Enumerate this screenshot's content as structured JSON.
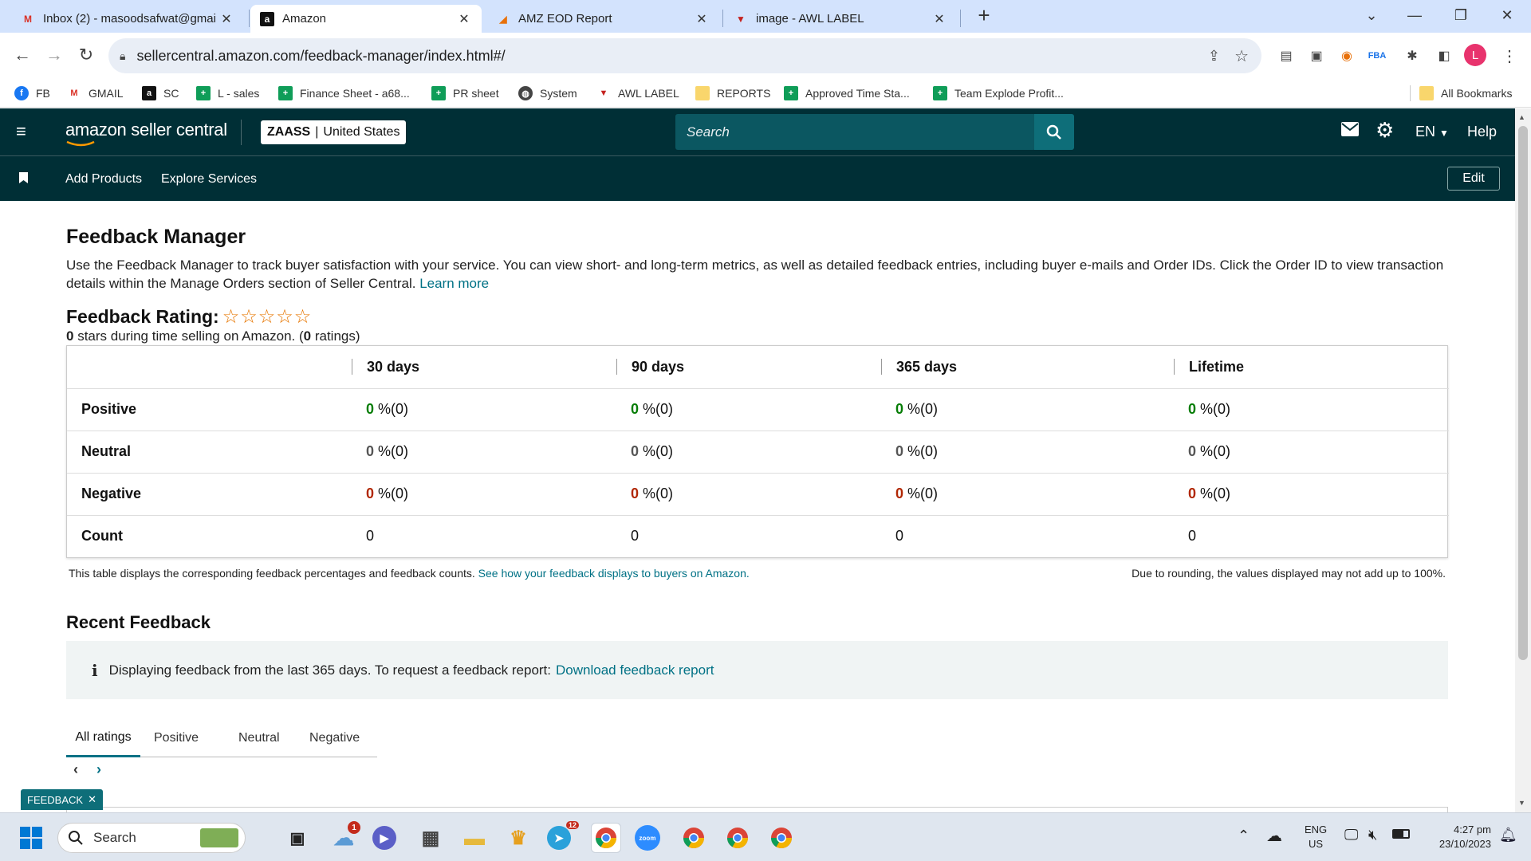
{
  "browser": {
    "tabs": [
      {
        "label": "Inbox (2) - masoodsafwat@gmai",
        "icon": "gmail-icon"
      },
      {
        "label": "Amazon",
        "icon": "amazon-icon"
      },
      {
        "label": "AMZ EOD Report",
        "icon": "report-icon"
      },
      {
        "label": "image - AWL LABEL",
        "icon": "awl-icon"
      }
    ],
    "url": "sellercentral.amazon.com/feedback-manager/index.html#/",
    "profile_initial": "L",
    "bookmarks": [
      {
        "label": "FB",
        "icon": "facebook-icon"
      },
      {
        "label": "GMAIL",
        "icon": "gmail-icon"
      },
      {
        "label": "SC",
        "icon": "amazon-icon"
      },
      {
        "label": "L - sales",
        "icon": "sheets-icon"
      },
      {
        "label": "Finance Sheet - a68...",
        "icon": "sheets-icon"
      },
      {
        "label": "PR sheet",
        "icon": "sheets-icon"
      },
      {
        "label": "System",
        "icon": "globe-icon"
      },
      {
        "label": "AWL LABEL",
        "icon": "awl-icon"
      },
      {
        "label": "REPORTS",
        "icon": "folder-icon"
      },
      {
        "label": "Approved Time Sta...",
        "icon": "sheets-icon"
      },
      {
        "label": "Team Explode Profit...",
        "icon": "sheets-icon"
      }
    ],
    "all_bookmarks": "All Bookmarks"
  },
  "seller_central": {
    "logo_text": "amazon seller central",
    "store": "ZAASS",
    "marketplace": "United States",
    "search_placeholder": "Search",
    "language": "EN",
    "help": "Help",
    "nav": [
      "Add Products",
      "Explore Services"
    ],
    "edit": "Edit"
  },
  "page": {
    "title": "Feedback Manager",
    "description": "Use the Feedback Manager to track buyer satisfaction with your service. You can view short- and long-term metrics, as well as detailed feedback entries, including buyer e-mails and Order IDs. Click the Order ID to view transaction details within the Manage Orders section of Seller Central.",
    "learn_more": "Learn more",
    "rating_label": "Feedback Rating:",
    "rating_stars": 0,
    "summary_stars": "0",
    "summary_mid": " stars during time selling on Amazon. (",
    "summary_count": "0",
    "summary_end": " ratings)",
    "table": {
      "columns": [
        "30 days",
        "90 days",
        "365 days",
        "Lifetime"
      ],
      "rows": [
        {
          "label": "Positive",
          "values": [
            "0",
            "0",
            "0",
            "0"
          ],
          "suffix": " %(0)",
          "color": "#067d06"
        },
        {
          "label": "Neutral",
          "values": [
            "0",
            "0",
            "0",
            "0"
          ],
          "suffix": " %(0)",
          "color": "#555555"
        },
        {
          "label": "Negative",
          "values": [
            "0",
            "0",
            "0",
            "0"
          ],
          "suffix": " %(0)",
          "color": "#b12704"
        },
        {
          "label": "Count",
          "values": [
            "0",
            "0",
            "0",
            "0"
          ],
          "suffix": "",
          "color": "#555555"
        }
      ]
    },
    "table_note": "This table displays the corresponding feedback percentages and feedback counts.",
    "table_note_link": "See how your feedback displays to buyers on Amazon.",
    "rounding_note": "Due to rounding, the values displayed may not add up to 100%.",
    "recent_title": "Recent Feedback",
    "info_text": "Displaying feedback from the last 365 days. To request a feedback report:",
    "info_link": "Download feedback report",
    "filter_tabs": [
      "All ratings",
      "Positive",
      "Neutral",
      "Negative"
    ],
    "feedback_badge": "FEEDBACK"
  },
  "taskbar": {
    "search_placeholder": "Search",
    "weather_badge": "1",
    "telegram_badge": "12",
    "lang_top": "ENG",
    "lang_bottom": "US",
    "time": "4:27 pm",
    "date": "23/10/2023"
  },
  "colors": {
    "sc_dark": "#002f36",
    "link": "#007185",
    "tab_strip": "#d3e3fd",
    "positive": "#067d06",
    "negative": "#b12704",
    "star": "#e77600"
  }
}
